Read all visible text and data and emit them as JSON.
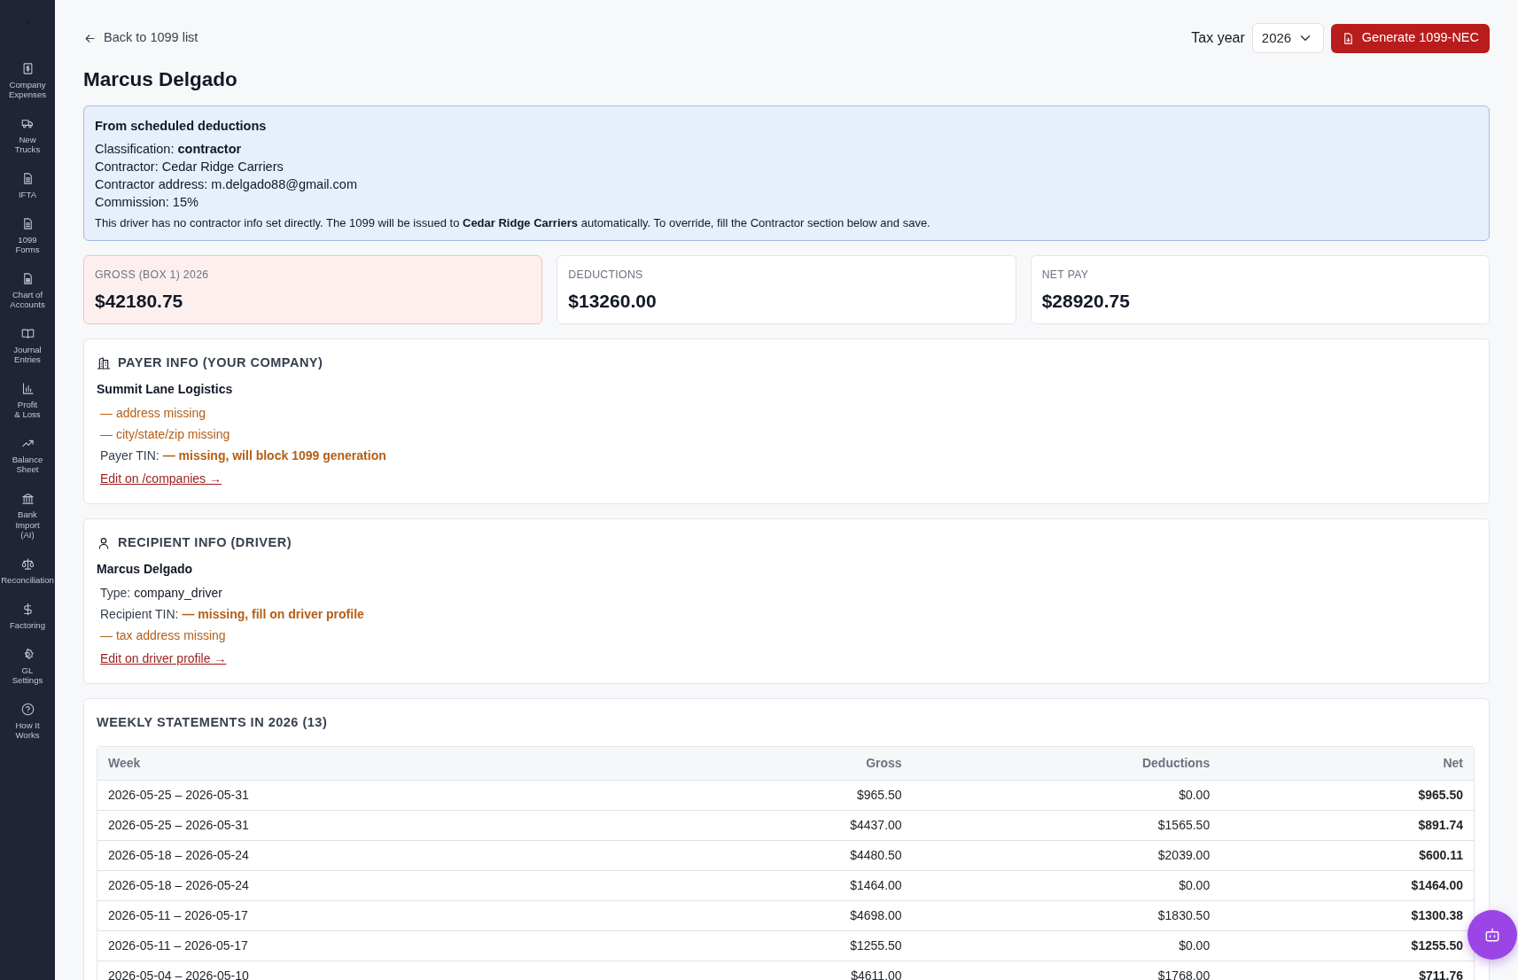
{
  "sidebar": {
    "items": [
      {
        "label": "Company\nExpenses"
      },
      {
        "label": "New\nTrucks"
      },
      {
        "label": "IFTA"
      },
      {
        "label": "1099\nForms"
      },
      {
        "label": "Chart of\nAccounts"
      },
      {
        "label": "Journal\nEntries"
      },
      {
        "label": "Profit\n& Loss"
      },
      {
        "label": "Balance\nSheet"
      },
      {
        "label": "Bank\nImport\n(AI)"
      },
      {
        "label": "Reconciliation"
      },
      {
        "label": "Factoring"
      },
      {
        "label": "GL\nSettings"
      },
      {
        "label": "How It\nWorks"
      }
    ]
  },
  "header": {
    "back_link": "Back to 1099 list",
    "tax_year_label": "Tax year",
    "tax_year": "2026",
    "generate_button": "Generate 1099-NEC"
  },
  "title": "Marcus Delgado",
  "info_box": {
    "heading": "From scheduled deductions",
    "lines": [
      "Classification: **contractor**",
      "Contractor: Cedar Ridge Carriers",
      "Contractor address: m.delgado88@gmail.com",
      "Commission: 15%"
    ],
    "note": "This driver has no contractor info set directly. The 1099 will be issued to **Cedar Ridge Carriers** automatically. To override, fill the Contractor section below and save."
  },
  "stats": [
    {
      "label": "GROSS (BOX 1) 2026",
      "value": "$42180.75",
      "highlighted": true
    },
    {
      "label": "DEDUCTIONS",
      "value": "$13260.00",
      "highlighted": false
    },
    {
      "label": "NET PAY",
      "value": "$28920.75",
      "highlighted": false
    }
  ],
  "payer": {
    "heading": "PAYER INFO (YOUR COMPANY)",
    "name": "Summit Lane Logistics",
    "lines": [
      {
        "kind": "warning",
        "text": "— address missing"
      },
      {
        "kind": "warning",
        "text": "— city/state/zip missing"
      },
      {
        "kind": "field",
        "label": "Payer TIN:",
        "value": "— missing, will block 1099 generation",
        "missing": true
      }
    ],
    "link": "Edit on /companies →"
  },
  "recipient": {
    "heading": "RECIPIENT INFO (DRIVER)",
    "name": "Marcus Delgado",
    "lines": [
      {
        "kind": "field",
        "label": "Type:",
        "value": "company_driver",
        "missing": false
      },
      {
        "kind": "field",
        "label": "Recipient TIN:",
        "value": "— missing, fill on driver profile",
        "missing": true
      },
      {
        "kind": "warning",
        "text": "— tax address missing"
      }
    ],
    "link": "Edit on driver profile →"
  },
  "statements": {
    "heading": "WEEKLY STATEMENTS IN 2026 (13)",
    "columns": [
      "Week",
      "Gross",
      "Deductions",
      "Net"
    ],
    "rows": [
      [
        "2026-05-25 – 2026-05-31",
        "$965.50",
        "$0.00",
        "$965.50"
      ],
      [
        "2026-05-25 – 2026-05-31",
        "$4437.00",
        "$1565.50",
        "$891.74"
      ],
      [
        "2026-05-18 – 2026-05-24",
        "$4480.50",
        "$2039.00",
        "$600.11"
      ],
      [
        "2026-05-18 – 2026-05-24",
        "$1464.00",
        "$0.00",
        "$1464.00"
      ],
      [
        "2026-05-11 – 2026-05-17",
        "$4698.00",
        "$1830.50",
        "$1300.38"
      ],
      [
        "2026-05-11 – 2026-05-17",
        "$1255.50",
        "$0.00",
        "$1255.50"
      ],
      [
        "2026-05-04 – 2026-05-10",
        "$4611.00",
        "$1768.00",
        "$711.76"
      ]
    ]
  }
}
